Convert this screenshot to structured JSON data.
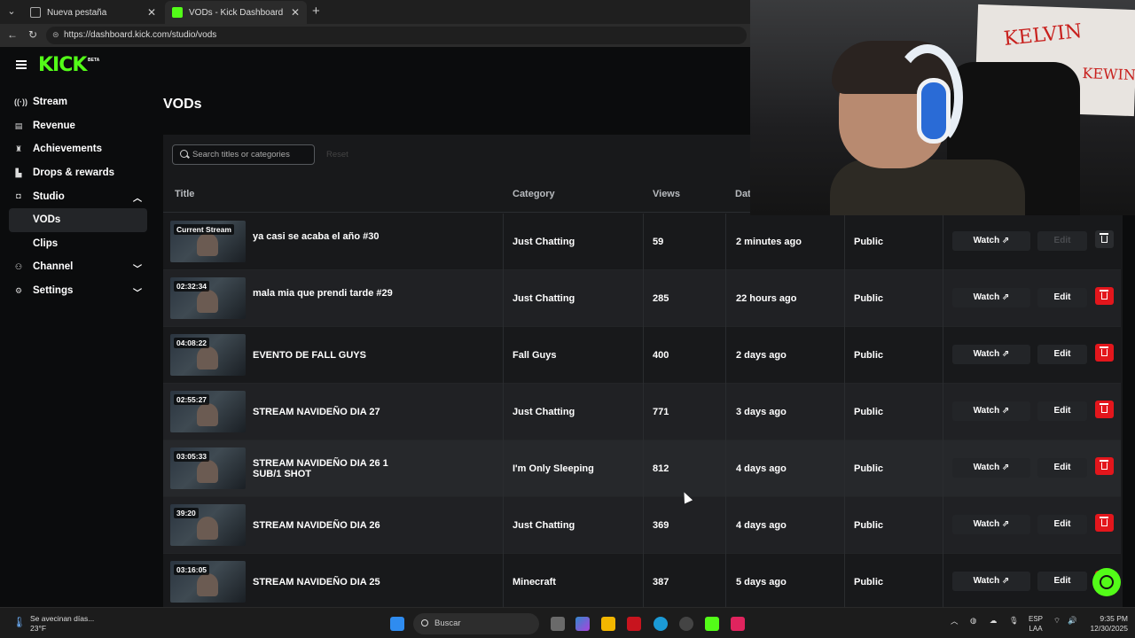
{
  "browser": {
    "tabs": [
      {
        "title": "Nueva pestaña",
        "icon": "page-icon"
      },
      {
        "title": "VODs - Kick Dashboard",
        "icon": "kick-icon",
        "active": true
      }
    ],
    "url": "https://dashboard.kick.com/studio/vods"
  },
  "brand": {
    "logo": "KICK",
    "beta": "BETA",
    "accent": "#53fc18"
  },
  "sidebar": {
    "items": [
      {
        "label": "Stream",
        "icon": "stream-icon"
      },
      {
        "label": "Revenue",
        "icon": "revenue-icon"
      },
      {
        "label": "Achievements",
        "icon": "trophy-icon"
      },
      {
        "label": "Drops & rewards",
        "icon": "gift-icon"
      },
      {
        "label": "Studio",
        "icon": "studio-icon",
        "expanded": true
      },
      {
        "label": "VODs",
        "active": true
      },
      {
        "label": "Clips"
      },
      {
        "label": "Channel",
        "icon": "channel-icon",
        "expanded": false
      },
      {
        "label": "Settings",
        "icon": "settings-icon",
        "expanded": false
      }
    ]
  },
  "main": {
    "title": "VODs",
    "search": {
      "placeholder": "Search titles or categories",
      "value": ""
    },
    "reset_label": "Reset",
    "columns": [
      "Title",
      "Category",
      "Views",
      "Dat"
    ],
    "rows": [
      {
        "badge": "Current Stream",
        "title": "ya casi se acaba el año #30",
        "category": "Just Chatting",
        "views": "59",
        "date": "2 minutes ago",
        "visibility": "Public",
        "edit_disabled": true
      },
      {
        "badge": "02:32:34",
        "title": "mala mia que prendi tarde #29",
        "category": "Just Chatting",
        "views": "285",
        "date": "22 hours ago",
        "visibility": "Public"
      },
      {
        "badge": "04:08:22",
        "title": "EVENTO DE FALL GUYS",
        "category": "Fall Guys",
        "views": "400",
        "date": "2 days ago",
        "visibility": "Public"
      },
      {
        "badge": "02:55:27",
        "title": "STREAM NAVIDEÑO DIA 27",
        "category": "Just Chatting",
        "views": "771",
        "date": "3 days ago",
        "visibility": "Public"
      },
      {
        "badge": "03:05:33",
        "title": "STREAM NAVIDEÑO DIA 26 1 SUB/1 SHOT",
        "category": "I'm Only Sleeping",
        "views": "812",
        "date": "4 days ago",
        "visibility": "Public"
      },
      {
        "badge": "39:20",
        "title": "STREAM NAVIDEÑO DIA 26",
        "category": "Just Chatting",
        "views": "369",
        "date": "4 days ago",
        "visibility": "Public"
      },
      {
        "badge": "03:16:05",
        "title": "STREAM NAVIDEÑO DIA 25",
        "category": "Minecraft",
        "views": "387",
        "date": "5 days ago",
        "visibility": "Public"
      }
    ],
    "watch_label": "Watch",
    "edit_label": "Edit"
  },
  "webcam": {
    "board_text": "KELVIN",
    "board_text2": "KEWIN"
  },
  "taskbar": {
    "weather_line1": "Se avecinan días...",
    "weather_line2": "23°F",
    "search_label": "Buscar",
    "lang_line1": "ESP",
    "lang_line2": "LAA",
    "time": "9:35 PM",
    "date": "12/30/2025"
  }
}
